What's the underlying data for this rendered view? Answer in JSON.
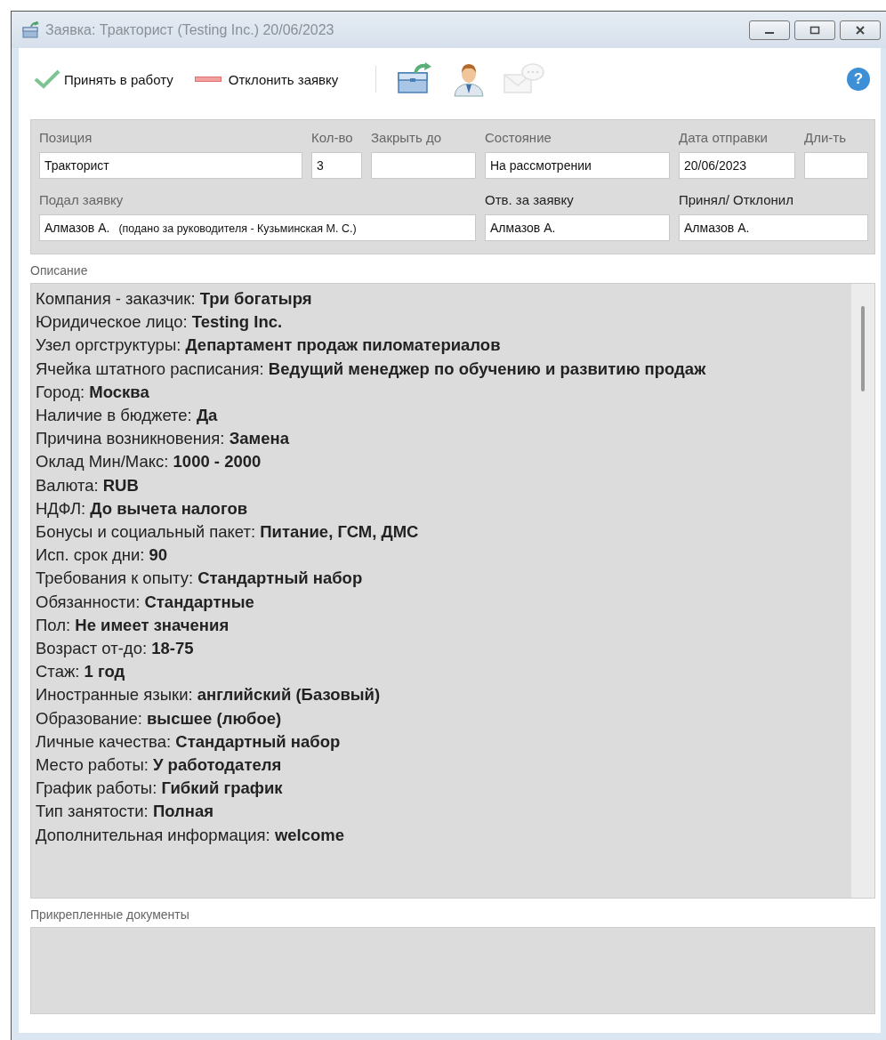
{
  "window": {
    "title": "Заявка: Тракторист (Testing Inc.) 20/06/2023"
  },
  "toolbar": {
    "actions": [
      {
        "kind": "accept",
        "label": "Принять в работу"
      },
      {
        "kind": "reject",
        "label": "Отклонить заявку"
      }
    ],
    "tools": [
      {
        "kind": "briefcase",
        "disabled": false
      },
      {
        "kind": "person",
        "disabled": false
      },
      {
        "kind": "message",
        "disabled": true
      }
    ],
    "help": "?"
  },
  "form": {
    "row1": [
      {
        "label": "Позиция",
        "value": "Тракторист",
        "emphasized": false
      },
      {
        "label": "Кол-во",
        "value": "3",
        "emphasized": false
      },
      {
        "label": "Закрыть до",
        "emphasized": false
      },
      {
        "label": "Состояние",
        "value": "На рассмотрении",
        "emphasized": false
      },
      {
        "label": "Дата отправки",
        "value": "20/06/2023",
        "emphasized": false
      },
      {
        "label": "Дли-ть",
        "emphasized": false
      }
    ],
    "row2": [
      {
        "label": "Подал заявку",
        "value": "Алмазов А.",
        "note": "(подано за руководителя - Кузьминская М. С.)",
        "emphasized": false
      },
      {
        "label": "Отв. за заявку",
        "value": "Алмазов А.",
        "emphasized": true
      },
      {
        "label": "Принял/ Отклонил",
        "value": "Алмазов А.",
        "emphasized": true
      }
    ]
  },
  "description": {
    "label": "Описание",
    "lines": [
      "Компания - заказчик: **Три богатыря**",
      "Юридическое лицо: **Testing Inc.**",
      "Узел оргструктуры: **Департамент продаж пиломатериалов**",
      "Ячейка штатного расписания: **Ведущий менеджер по обучению и развитию продаж**",
      "Город: **Москва**",
      "Наличие в бюджете: **Да**",
      "Причина возникновения: **Замена**",
      "Оклад Мин/Макс: **1000 - 2000**",
      "Валюта: **RUB**",
      "НДФЛ: **До вычета налогов**",
      "Бонусы и социальный пакет: **Питание, ГСМ, ДМС**",
      "Исп. срок дни: **90**",
      "Требования к опыту: **Стандартный набор**",
      "Обязанности: **Стандартные**",
      "Пол: **Не имеет значения**",
      "Возраст от-до: **18-75**",
      "Стаж: **1 год**",
      "Иностранные языки: **английский (Базовый)**",
      "Образование: **высшее (любое)**",
      "Личные качества: **Стандартный набор**",
      "Место работы: **У работодателя**",
      "График работы: **Гибкий график**",
      "Тип занятости: **Полная**",
      "Дополнительная информация: **welcome**"
    ]
  },
  "attachments": {
    "label": "Прикрепленные документы"
  }
}
